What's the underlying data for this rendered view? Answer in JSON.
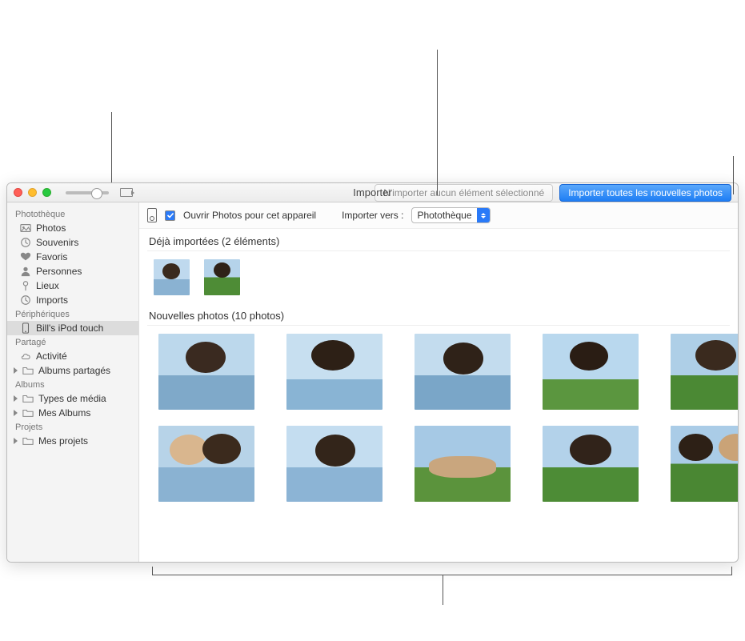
{
  "window": {
    "title": "Importer"
  },
  "toolbar": {
    "import_selected_label": "N'importer aucun élément sélectionné",
    "import_all_label": "Importer toutes les nouvelles photos"
  },
  "import_bar": {
    "open_photos_label": "Ouvrir Photos pour cet appareil",
    "import_to_label": "Importer vers :",
    "import_to_value": "Photothèque",
    "checkbox_checked": true
  },
  "sections": {
    "already_imported": "Déjà importées (2 éléments)",
    "new_photos": "Nouvelles photos (10 photos)"
  },
  "sidebar": {
    "groups": [
      {
        "header": "Photothèque",
        "items": [
          {
            "label": "Photos",
            "icon": "photos"
          },
          {
            "label": "Souvenirs",
            "icon": "clock"
          },
          {
            "label": "Favoris",
            "icon": "heart"
          },
          {
            "label": "Personnes",
            "icon": "person"
          },
          {
            "label": "Lieux",
            "icon": "pin"
          },
          {
            "label": "Imports",
            "icon": "clock"
          }
        ]
      },
      {
        "header": "Périphériques",
        "items": [
          {
            "label": "Bill's iPod touch",
            "icon": "device",
            "selected": true
          }
        ]
      },
      {
        "header": "Partagé",
        "items": [
          {
            "label": "Activité",
            "icon": "cloud"
          },
          {
            "label": "Albums partagés",
            "icon": "folder",
            "disclosure": true
          }
        ]
      },
      {
        "header": "Albums",
        "items": [
          {
            "label": "Types de média",
            "icon": "folder",
            "disclosure": true
          },
          {
            "label": "Mes Albums",
            "icon": "folder",
            "disclosure": true
          }
        ]
      },
      {
        "header": "Projets",
        "items": [
          {
            "label": "Mes projets",
            "icon": "folder",
            "disclosure": true
          }
        ]
      }
    ]
  },
  "thumbnails": {
    "already": [
      {
        "style": "ts1"
      },
      {
        "style": "ts2"
      }
    ],
    "new": [
      {
        "style": "p1"
      },
      {
        "style": "p2"
      },
      {
        "style": "p3"
      },
      {
        "style": "p4"
      },
      {
        "style": "p5"
      },
      {
        "style": "p6"
      },
      {
        "style": "p7"
      },
      {
        "style": "p8"
      },
      {
        "style": "p9"
      },
      {
        "style": "p10"
      }
    ]
  }
}
